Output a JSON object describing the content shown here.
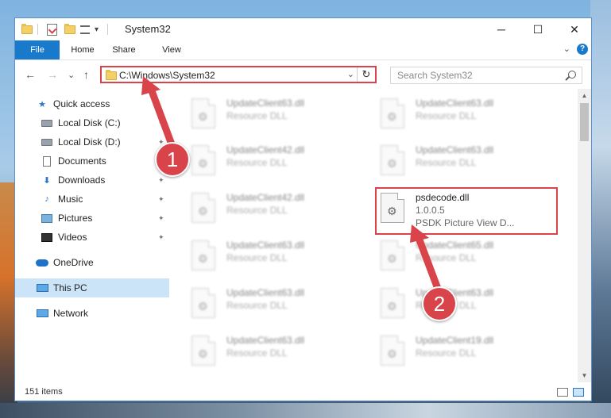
{
  "window": {
    "title": "System32",
    "controls": {
      "minimize": "─",
      "maximize": "☐",
      "close": "✕"
    }
  },
  "ribbon": {
    "tabs": [
      "File",
      "Home",
      "Share",
      "View"
    ],
    "collapse_glyph": "⌄",
    "help_glyph": "?"
  },
  "nav": {
    "back": "←",
    "forward": "→",
    "recent": "⌄",
    "up": "↑",
    "address": "C:\\Windows\\System32",
    "address_dropdown": "⌄",
    "refresh": "↻",
    "search_placeholder": "Search System32"
  },
  "sidebar": {
    "items": [
      {
        "label": "Quick access",
        "icon": "star-icon",
        "pinned": false
      },
      {
        "label": "Local Disk (C:)",
        "icon": "disk-icon",
        "pinned": true
      },
      {
        "label": "Local Disk (D:)",
        "icon": "disk-icon",
        "pinned": true
      },
      {
        "label": "Documents",
        "icon": "document-icon",
        "pinned": true
      },
      {
        "label": "Downloads",
        "icon": "download-icon",
        "pinned": true
      },
      {
        "label": "Music",
        "icon": "music-icon",
        "pinned": true
      },
      {
        "label": "Pictures",
        "icon": "pictures-icon",
        "pinned": true
      },
      {
        "label": "Videos",
        "icon": "videos-icon",
        "pinned": true
      },
      {
        "label": "OneDrive",
        "icon": "onedrive-icon",
        "pinned": false
      },
      {
        "label": "This PC",
        "icon": "this-pc-icon",
        "pinned": false,
        "selected": true
      },
      {
        "label": "Network",
        "icon": "network-icon",
        "pinned": false
      }
    ],
    "pin_glyph": "📌"
  },
  "files": {
    "left_column": [
      {
        "name": "UpdateClient63.dll",
        "type": "Resource DLL"
      },
      {
        "name": "UpdateClient42.dll",
        "type": "Resource DLL"
      },
      {
        "name": "UpdateClient42.dll",
        "type": "Resource DLL"
      },
      {
        "name": "UpdateClient63.dll",
        "type": "Resource DLL"
      },
      {
        "name": "UpdateClient63.dll",
        "type": "Resource DLL"
      },
      {
        "name": "UpdateClient63.dll",
        "type": "Resource DLL"
      }
    ],
    "right_column": [
      {
        "name": "UpdateClient63.dll",
        "type": "Resource DLL"
      },
      {
        "name": "UpdateClient63.dll",
        "type": "Resource DLL"
      },
      {
        "name": "psdecode.dll",
        "version": "1.0.0.5",
        "description": "PSDK Picture View D...",
        "highlighted": true
      },
      {
        "name": "UpdateClient65.dll",
        "type": "Resource DLL"
      },
      {
        "name": "UpdateClient63.dll",
        "type": "Resource DLL"
      },
      {
        "name": "UpdateClient19.dll",
        "type": "Resource DLL"
      }
    ]
  },
  "status": {
    "item_count": "151 items"
  },
  "callouts": [
    "1",
    "2"
  ],
  "colors": {
    "accent": "#1979ca",
    "highlight": "#d9444a",
    "selected": "#cce4f7"
  }
}
